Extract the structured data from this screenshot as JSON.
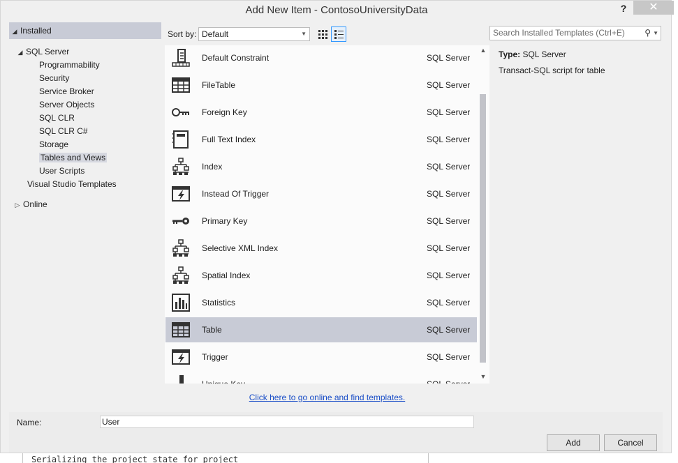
{
  "window": {
    "title": "Add New Item - ContosoUniversityData",
    "help": "?",
    "close": "✕"
  },
  "tree": {
    "installed": "Installed",
    "sql_server": "SQL Server",
    "children": [
      "Programmability",
      "Security",
      "Service Broker",
      "Server Objects",
      "SQL CLR",
      "SQL CLR C#",
      "Storage",
      "Tables and Views",
      "User Scripts"
    ],
    "selected": "Tables and Views",
    "vs_templates": "Visual Studio Templates",
    "online": "Online"
  },
  "toolbar": {
    "sort_label": "Sort by:",
    "sort_value": "Default",
    "search_placeholder": "Search Installed Templates (Ctrl+E)"
  },
  "items": [
    {
      "name": "Default Constraint",
      "category": "SQL Server",
      "icon": "default-constraint-icon"
    },
    {
      "name": "FileTable",
      "category": "SQL Server",
      "icon": "table-icon"
    },
    {
      "name": "Foreign Key",
      "category": "SQL Server",
      "icon": "key-icon"
    },
    {
      "name": "Full Text Index",
      "category": "SQL Server",
      "icon": "full-text-index-icon"
    },
    {
      "name": "Index",
      "category": "SQL Server",
      "icon": "hierarchy-icon"
    },
    {
      "name": "Instead Of Trigger",
      "category": "SQL Server",
      "icon": "trigger-icon"
    },
    {
      "name": "Primary Key",
      "category": "SQL Server",
      "icon": "primary-key-icon"
    },
    {
      "name": "Selective XML Index",
      "category": "SQL Server",
      "icon": "hierarchy-icon"
    },
    {
      "name": "Spatial Index",
      "category": "SQL Server",
      "icon": "hierarchy-icon"
    },
    {
      "name": "Statistics",
      "category": "SQL Server",
      "icon": "statistics-icon"
    },
    {
      "name": "Table",
      "category": "SQL Server",
      "icon": "table-icon"
    },
    {
      "name": "Trigger",
      "category": "SQL Server",
      "icon": "trigger-icon"
    },
    {
      "name": "Unique Key",
      "category": "SQL Server",
      "icon": "unique-key-icon"
    }
  ],
  "selected_item": "Table",
  "details": {
    "type_label": "Type:",
    "type_value": "SQL Server",
    "description": "Transact-SQL script for table"
  },
  "online_link": "Click here to go online and find templates.",
  "name_field": {
    "label": "Name:",
    "value": "User"
  },
  "buttons": {
    "add": "Add",
    "cancel": "Cancel"
  },
  "background_output": "Serializing the project state for project 'ContosoUniversityData.sqlproj'..."
}
